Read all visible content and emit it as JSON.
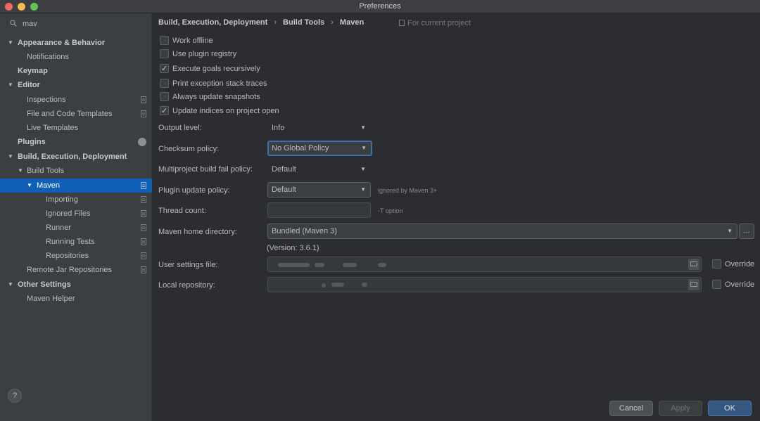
{
  "window": {
    "title": "Preferences"
  },
  "sidebar": {
    "search_text": "mav",
    "items": [
      {
        "label": "Appearance & Behavior"
      },
      {
        "label": "Notifications"
      },
      {
        "label": "Keymap"
      },
      {
        "label": "Editor"
      },
      {
        "label": "Inspections"
      },
      {
        "label": "File and Code Templates"
      },
      {
        "label": "Live Templates"
      },
      {
        "label": "Plugins"
      },
      {
        "label": "Build, Execution, Deployment"
      },
      {
        "label": "Build Tools"
      },
      {
        "label": "Maven"
      },
      {
        "label": "Importing"
      },
      {
        "label": "Ignored Files"
      },
      {
        "label": "Runner"
      },
      {
        "label": "Running Tests"
      },
      {
        "label": "Repositories"
      },
      {
        "label": "Remote Jar Repositories"
      },
      {
        "label": "Other Settings"
      },
      {
        "label": "Maven Helper"
      }
    ],
    "help_label": "?"
  },
  "breadcrumb": {
    "parts": [
      "Build, Execution, Deployment",
      "Build Tools",
      "Maven"
    ],
    "separator": "›",
    "for_project": "For current project"
  },
  "options": {
    "work_offline": {
      "label": "Work offline",
      "checked": false
    },
    "use_plugin_registry": {
      "label": "Use plugin registry",
      "checked": false
    },
    "execute_goals_recursively": {
      "label": "Execute goals recursively",
      "checked": true
    },
    "print_exception_stack_traces": {
      "label": "Print exception stack traces",
      "checked": false
    },
    "always_update_snapshots": {
      "label": "Always update snapshots",
      "checked": false
    },
    "update_indices": {
      "label": "Update indices on project open",
      "checked": true
    }
  },
  "form": {
    "output_level": {
      "label": "Output level:",
      "value": "Info"
    },
    "checksum_policy": {
      "label": "Checksum policy:",
      "value": "No Global Policy"
    },
    "multiproject_fail_policy": {
      "label": "Multiproject build fail policy:",
      "value": "Default"
    },
    "plugin_update_policy": {
      "label": "Plugin update policy:",
      "value": "Default",
      "hint": "ignored by Maven 3+"
    },
    "thread_count": {
      "label": "Thread count:",
      "value": "",
      "hint": "-T option"
    },
    "maven_home": {
      "label": "Maven home directory:",
      "value": "Bundled (Maven 3)",
      "version": "(Version: 3.6.1)",
      "browse_label": "..."
    },
    "user_settings": {
      "label": "User settings file:",
      "override_label": "Override"
    },
    "local_repo": {
      "label": "Local repository:",
      "override_label": "Override"
    }
  },
  "buttons": {
    "cancel": "Cancel",
    "apply": "Apply",
    "ok": "OK"
  },
  "colors": {
    "accent": "#0d60b5",
    "ok_button": "#365880",
    "focus_border": "#3d6fa8"
  }
}
